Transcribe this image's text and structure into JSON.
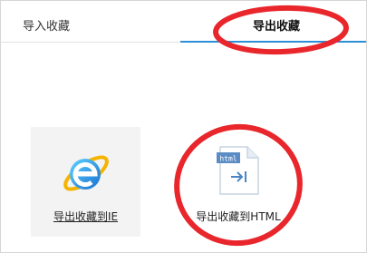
{
  "tabs": {
    "import_label": "导入收藏",
    "export_label": "导出收藏"
  },
  "options": {
    "ie_label": "导出收藏到IE",
    "html_label": "导出收藏到HTML",
    "html_badge": "html"
  },
  "colors": {
    "accent": "#2d8fd8",
    "annotation": "#e8262b",
    "ie_tile_bg": "#f3f3f3"
  },
  "icons": [
    "ie-icon",
    "html-file-icon"
  ]
}
